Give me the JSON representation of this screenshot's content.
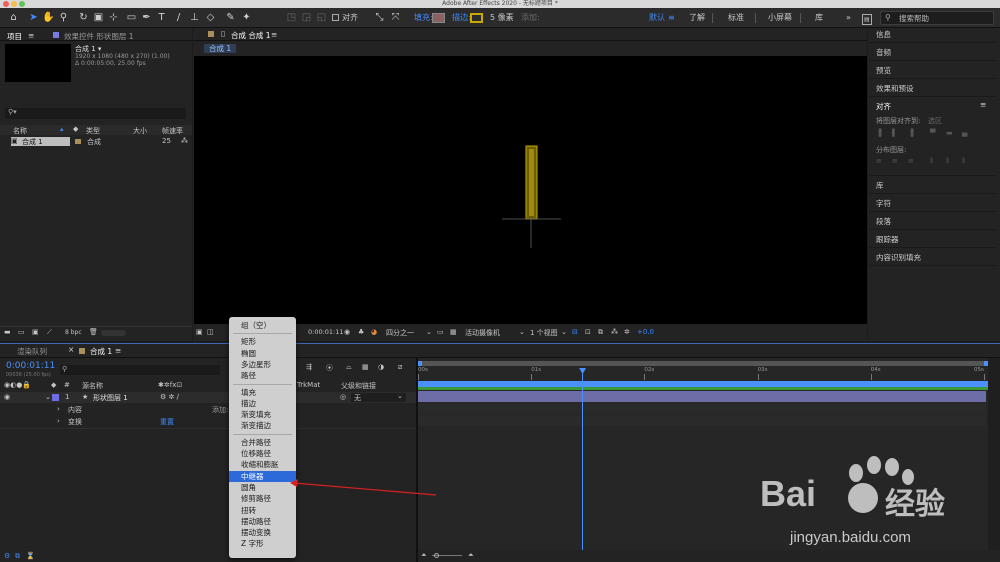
{
  "window": {
    "title": "Adobe After Effects 2020 - 无标题项目 *"
  },
  "toolbar": {
    "align_label": "对齐",
    "fill_label": "填充:",
    "stroke_label": "描边:",
    "stroke_width": "5 像素",
    "add_label": "添加:",
    "fill_color": "#8a6262",
    "stroke_color": "#c9a800",
    "workspaces": [
      "默认",
      "了解",
      "标准",
      "小屏幕",
      "库"
    ],
    "search_placeholder": "搜索帮助"
  },
  "project_panel": {
    "tab_project": "项目",
    "tab_effects": "效果控件 形状图层 1",
    "comp_name": "合成 1 ▾",
    "comp_size": "1920 x 1080 (480 x 270) (1.00)",
    "comp_duration": "Δ 0:00:05:00, 25.00 fps",
    "columns": {
      "name": "名称",
      "type": "类型",
      "size": "大小",
      "fps": "帧速率"
    },
    "items": [
      {
        "name": "合成 1",
        "type": "合成",
        "fps": "25"
      }
    ],
    "bpc": "8 bpc"
  },
  "composition_panel": {
    "tab_label": "合成 合成 1",
    "breadcrumb": "合成 1",
    "timecode": "0:00:01:11",
    "resolution": "四分之一",
    "camera": "活动摄像机",
    "views": "1 个视图",
    "exposure": "+0.0"
  },
  "right_panel": {
    "items_top": [
      "信息",
      "音频",
      "预览",
      "效果和预设"
    ],
    "align": {
      "title": "对齐",
      "align_to_label": "将图层对齐到:",
      "align_to_value": "选区",
      "distribute_label": "分布图层:"
    },
    "items_bottom": [
      "库",
      "字符",
      "段落",
      "跟踪器",
      "内容识别填充"
    ]
  },
  "timeline": {
    "tab_render": "渲染队列",
    "tab_comp": "合成 1",
    "timecode": "0:00:01:11",
    "frame_info": "00036 (25.00 fps)",
    "columns": {
      "num": "#",
      "source": "源名称",
      "trkmat": "TrkMat",
      "parent": "父级和链接"
    },
    "layer": {
      "num": "1",
      "name": "形状图层 1",
      "parent": "无"
    },
    "sub_rows": [
      {
        "label": "内容",
        "action": "添加: ●"
      },
      {
        "label": "变换",
        "action": "重置"
      }
    ],
    "ruler": [
      "00s",
      "01s",
      "02s",
      "03s",
      "04s",
      "05s"
    ],
    "playhead_fraction": 0.29
  },
  "context_menu": {
    "groups": [
      [
        "组（空）"
      ],
      [
        "矩形",
        "椭圆",
        "多边星形",
        "路径"
      ],
      [
        "填充",
        "描边",
        "渐变填充",
        "渐变描边"
      ],
      [
        "合并路径",
        "位移路径",
        "收缩和膨胀",
        "中继器",
        "圆角",
        "修剪路径",
        "扭转",
        "摆动路径",
        "摆动变换",
        "Z 字形"
      ]
    ],
    "selected": "中继器"
  },
  "watermark": {
    "brand": "Bai",
    "brand_cn": "经验",
    "url": "jingyan.baidu.com"
  }
}
